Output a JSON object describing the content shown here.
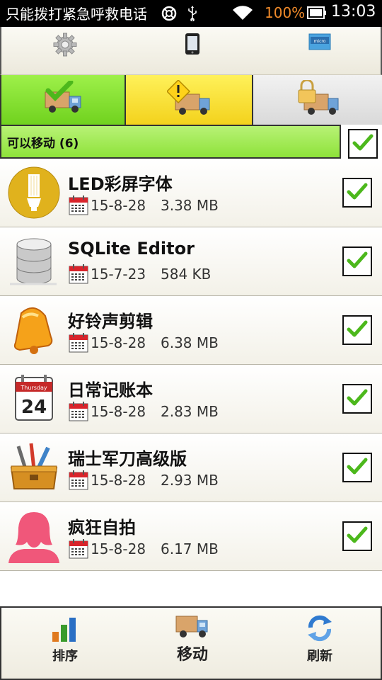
{
  "status_bar": {
    "carrier": "只能拨打紧急呼救电话",
    "battery_percent": "100%",
    "time": "13:03",
    "icons": [
      "lifebuoy-icon",
      "usb-icon",
      "wifi-icon",
      "battery-icon"
    ],
    "battery_color": "#f08a2a"
  },
  "tabs": [
    {
      "icon": "gear-icon"
    },
    {
      "icon": "phone-icon",
      "selected": true
    },
    {
      "icon": "sd-card-icon"
    }
  ],
  "categories": [
    {
      "icon": "truck-check-icon",
      "color": "#7ed62a"
    },
    {
      "icon": "truck-warning-icon",
      "color": "#f6dd2e"
    },
    {
      "icon": "truck-lock-icon",
      "color": "#e2e2e2"
    }
  ],
  "section": {
    "label": "可以移动 (6)",
    "checked": true
  },
  "apps": [
    {
      "name": "LED彩屏字体",
      "date": "15-8-28",
      "size": "3.38 MB",
      "icon": "lightbulb-icon",
      "checked": true
    },
    {
      "name": "SQLite Editor",
      "date": "15-7-23",
      "size": "584 KB",
      "icon": "database-icon",
      "checked": true
    },
    {
      "name": "好铃声剪辑",
      "date": "15-8-28",
      "size": "6.38 MB",
      "icon": "bell-icon",
      "checked": true
    },
    {
      "name": "日常记账本",
      "date": "15-8-28",
      "size": "2.83 MB",
      "icon": "calendar-icon",
      "checked": true
    },
    {
      "name": "瑞士军刀高级版",
      "date": "15-8-28",
      "size": "2.93 MB",
      "icon": "toolbox-icon",
      "checked": true
    },
    {
      "name": "疯狂自拍",
      "date": "15-8-28",
      "size": "6.17 MB",
      "icon": "woman-silhouette-icon",
      "checked": true
    }
  ],
  "calendar_badge": {
    "text": "Thursday",
    "day": "24"
  },
  "bottom_bar": {
    "sort_label": "排序",
    "move_label": "移动",
    "refresh_label": "刷新"
  },
  "accent": {
    "green": "#8ee23a",
    "check": "#4cb81c"
  }
}
